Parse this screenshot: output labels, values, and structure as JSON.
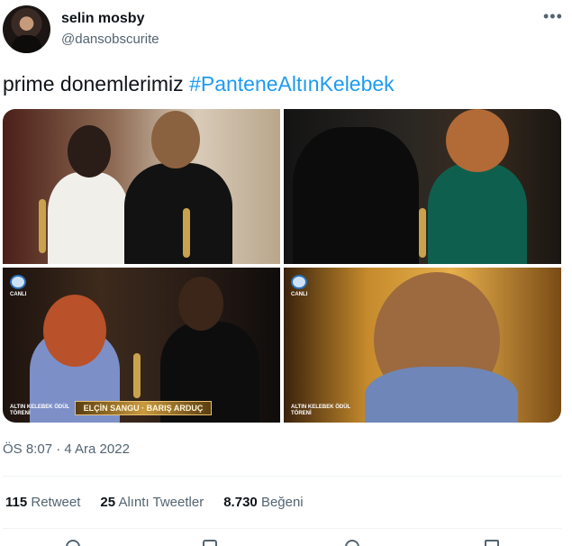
{
  "author": {
    "display_name": "selin mosby",
    "handle": "@dansobscurite",
    "avatar_icon": "profile-photo"
  },
  "more_icon": "more-options-icon",
  "tweet": {
    "text": "prime donemlerimiz",
    "hashtag": "#PanteneAltınKelebek"
  },
  "media": {
    "photos": [
      {
        "label": "photo-1"
      },
      {
        "label": "photo-2"
      },
      {
        "label": "photo-3",
        "brand_label": "CANLI",
        "corner_caption": "ALTIN KELEBEK ÖDÜL TÖRENİ",
        "caption_bar": "ELÇİN SANGU · BARIŞ ARDUÇ"
      },
      {
        "label": "photo-4",
        "brand_label": "CANLI",
        "corner_caption": "ALTIN KELEBEK ÖDÜL TÖRENİ"
      }
    ]
  },
  "timestamp": "ÖS 8:07 · 4 Ara 2022",
  "stats": {
    "retweets_count": "115",
    "retweets_label": "Retweet",
    "quotes_count": "25",
    "quotes_label": "Alıntı Tweetler",
    "likes_count": "8.730",
    "likes_label": "Beğeni"
  },
  "actions": [
    "reply-icon",
    "retweet-icon",
    "like-icon",
    "share-icon"
  ],
  "colors": {
    "accent": "#1d9bf0",
    "secondary_text": "#536471",
    "divider": "#eff3f4"
  }
}
